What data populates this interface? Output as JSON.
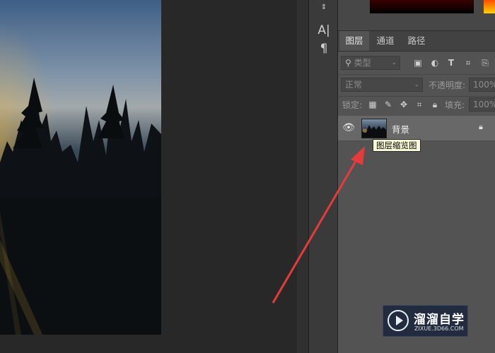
{
  "tools": {
    "text_icon": "A|",
    "paragraph_icon": "¶"
  },
  "panel": {
    "tabs": [
      {
        "label": "图层",
        "active": true
      },
      {
        "label": "通道",
        "active": false
      },
      {
        "label": "路径",
        "active": false
      }
    ],
    "filter": {
      "search_icon": "search-icon",
      "kind_value": "类型",
      "filter_icons": [
        "image-icon",
        "adjustment-icon",
        "type-icon",
        "shape-icon",
        "smart-object-icon"
      ]
    },
    "blend": {
      "mode_value": "正常",
      "opacity_label": "不透明度:",
      "opacity_value": "100%"
    },
    "lock": {
      "label": "锁定:",
      "fill_label": "填充:",
      "fill_value": "100%"
    },
    "layers": [
      {
        "name": "背景",
        "visible": true,
        "locked": true
      }
    ]
  },
  "tooltip": {
    "text": "图层缩览图"
  },
  "watermark": {
    "title": "溜溜自学",
    "subtitle": "ZIXUE.3D66.COM"
  },
  "colors": {
    "annotation_arrow": "#e63b3b",
    "panel_bg": "#535353",
    "selected_layer_bg": "#686868"
  }
}
